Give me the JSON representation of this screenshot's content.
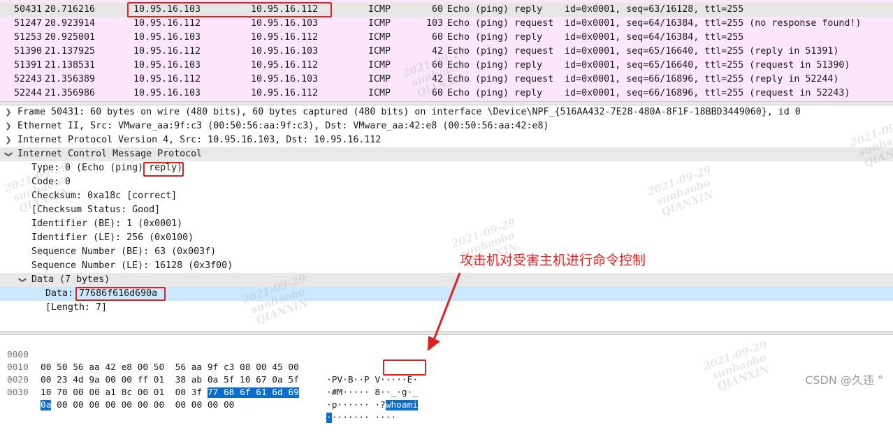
{
  "packets": [
    {
      "no": "50431",
      "time": "20.716216",
      "src": "10.95.16.103",
      "dst": "10.95.16.112",
      "proto": "ICMP",
      "len": "60",
      "info": "Echo (ping) reply    id=0x0001, seq=63/16128, ttl=255",
      "selected": true
    },
    {
      "no": "51247",
      "time": "20.923914",
      "src": "10.95.16.112",
      "dst": "10.95.16.103",
      "proto": "ICMP",
      "len": "103",
      "info": "Echo (ping) request  id=0x0001, seq=64/16384, ttl=255 (no response found!)"
    },
    {
      "no": "51253",
      "time": "20.925001",
      "src": "10.95.16.103",
      "dst": "10.95.16.112",
      "proto": "ICMP",
      "len": "60",
      "info": "Echo (ping) reply    id=0x0001, seq=64/16384, ttl=255"
    },
    {
      "no": "51390",
      "time": "21.137925",
      "src": "10.95.16.112",
      "dst": "10.95.16.103",
      "proto": "ICMP",
      "len": "42",
      "info": "Echo (ping) request  id=0x0001, seq=65/16640, ttl=255 (reply in 51391)"
    },
    {
      "no": "51391",
      "time": "21.138531",
      "src": "10.95.16.103",
      "dst": "10.95.16.112",
      "proto": "ICMP",
      "len": "60",
      "info": "Echo (ping) reply    id=0x0001, seq=65/16640, ttl=255 (request in 51390)"
    },
    {
      "no": "52243",
      "time": "21.356389",
      "src": "10.95.16.112",
      "dst": "10.95.16.103",
      "proto": "ICMP",
      "len": "42",
      "info": "Echo (ping) request  id=0x0001, seq=66/16896, ttl=255 (reply in 52244)"
    },
    {
      "no": "52244",
      "time": "21.356986",
      "src": "10.95.16.103",
      "dst": "10.95.16.112",
      "proto": "ICMP",
      "len": "60",
      "info": "Echo (ping) reply    id=0x0001, seq=66/16896, ttl=255 (request in 52243)"
    }
  ],
  "details": {
    "frame": "Frame 50431: 60 bytes on wire (480 bits), 60 bytes captured (480 bits) on interface \\Device\\NPF_{516AA432-7E28-480A-8F1F-18BBD3449060}, id 0",
    "ethernet": "Ethernet II, Src: VMware_aa:9f:c3 (00:50:56:aa:9f:c3), Dst: VMware_aa:42:e8 (00:50:56:aa:42:e8)",
    "ip": "Internet Protocol Version 4, Src: 10.95.16.103, Dst: 10.95.16.112",
    "icmp": "Internet Control Message Protocol",
    "type_prefix": "Type: 0 (Echo (ping) ",
    "type_value": "reply",
    "type_suffix": ")",
    "code": "Code: 0",
    "checksum": "Checksum: 0xa18c [correct]",
    "checksum_status": "[Checksum Status: Good]",
    "id_be": "Identifier (BE): 1 (0x0001)",
    "id_le": "Identifier (LE): 256 (0x0100)",
    "seq_be": "Sequence Number (BE): 63 (0x003f)",
    "seq_le": "Sequence Number (LE): 16128 (0x3f00)",
    "data_header": "Data (7 bytes)",
    "data_label": "Data: ",
    "data_value": "77686f616d690a",
    "data_length": "[Length: 7]"
  },
  "bytes": [
    {
      "off": "0000",
      "hex": "00 50 56 aa 42 e8 00 50  56 aa 9f c3 08 00 45 00",
      "hex_sel": "",
      "ascii": "·PV·B··P V·····E·",
      "ascii_sel": ""
    },
    {
      "off": "0010",
      "hex": "00 23 4d 9a 00 00 ff 01  38 ab 0a 5f 10 67 0a 5f",
      "hex_sel": "",
      "ascii": "·#M····· 8··_·g·_",
      "ascii_sel": ""
    },
    {
      "off": "0020",
      "hex": "10 70 00 00 a1 8c 00 01  00 3f ",
      "hex_sel": "77 68 6f 61 6d 69",
      "ascii": "·p······ ·?",
      "ascii_sel": "whoami"
    },
    {
      "off": "0030",
      "hex": " 00 00 00 00 00 00 00  00 00 00 00",
      "hex_sel": "0a",
      "ascii": "······· ····",
      "ascii_sel": "·"
    }
  ],
  "annotation": "攻击机对受害主机进行命令控制",
  "watermark": {
    "date": "2021-09-29",
    "user": "sunhaobo",
    "org": "QIANXIN"
  },
  "csdn": "CSDN @久违 °",
  "colors": {
    "packet_bg": "#fbe6fb",
    "selected_row": "#e6e6e6",
    "detail_selected": "#cce8ff",
    "hex_selected": "#0a6ed1",
    "annotation_red": "#e02020"
  }
}
